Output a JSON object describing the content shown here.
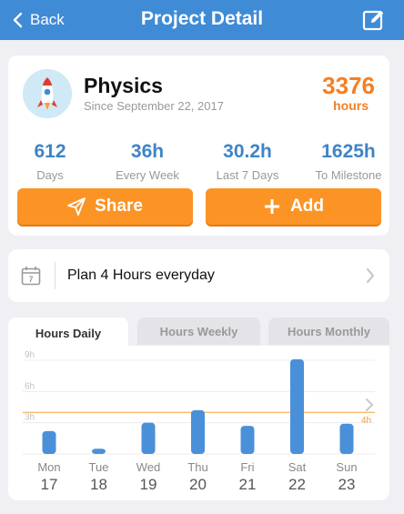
{
  "header": {
    "back_label": "Back",
    "title": "Project Detail"
  },
  "project": {
    "name": "Physics",
    "since": "Since September 22, 2017",
    "total_value": "3376",
    "total_unit": "hours",
    "stats": [
      {
        "value": "612",
        "label": "Days"
      },
      {
        "value": "36h",
        "label": "Every Week"
      },
      {
        "value": "30.2h",
        "label": "Last 7 Days"
      },
      {
        "value": "1625h",
        "label": "To Milestone"
      }
    ],
    "share_label": "Share",
    "add_label": "Add"
  },
  "plan": {
    "text": "Plan 4 Hours everyday",
    "calendar_day": "7"
  },
  "tabs": [
    {
      "label": "Hours Daily",
      "active": true
    },
    {
      "label": "Hours Weekly",
      "active": false
    },
    {
      "label": "Hours Monthly",
      "active": false
    }
  ],
  "colors": {
    "header": "#3f8bd6",
    "accent_orange": "#fb9425",
    "stat_blue": "#3f84c8",
    "bar_blue": "#4a90d9",
    "goal_line": "#f5a03a"
  },
  "chart_data": {
    "type": "bar",
    "categories": [
      "Mon 17",
      "Tue 18",
      "Wed 19",
      "Thu 20",
      "Fri 21",
      "Sat 22",
      "Sun 23"
    ],
    "day_names": [
      "Mon",
      "Tue",
      "Wed",
      "Thu",
      "Fri",
      "Sat",
      "Sun"
    ],
    "day_numbers": [
      "17",
      "18",
      "19",
      "20",
      "21",
      "22",
      "23"
    ],
    "values": [
      2.2,
      0.5,
      3.0,
      4.2,
      2.7,
      9.1,
      2.9
    ],
    "yticks": [
      {
        "value": 3,
        "label": "3h"
      },
      {
        "value": 6,
        "label": "6h"
      },
      {
        "value": 9,
        "label": "9h"
      }
    ],
    "ylim": [
      0,
      9.3
    ],
    "goal": {
      "value": 4,
      "label": "4h"
    },
    "grid": true
  }
}
